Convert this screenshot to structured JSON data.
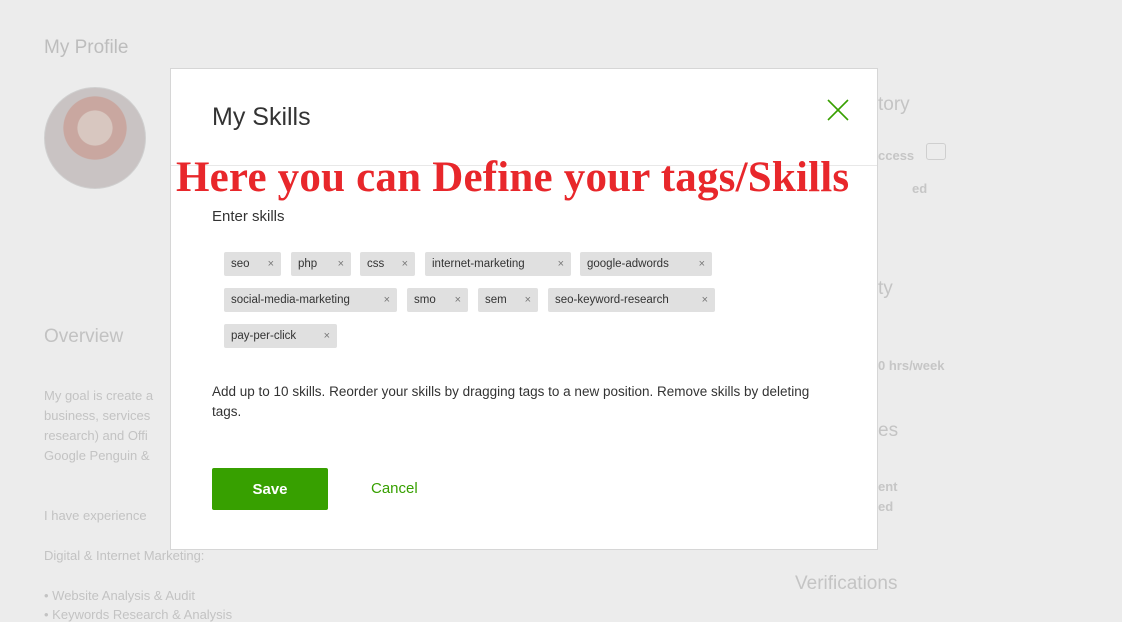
{
  "background": {
    "page_title": "My Profile",
    "overview_heading": "Overview",
    "overview_lines": [
      "My goal is create a",
      "business, services",
      "research) and Offi",
      "Google Penguin &"
    ],
    "experience_line": "I have experience",
    "digital_line": "Digital & Internet Marketing:",
    "bullets": [
      "• Website Analysis & Audit",
      "• Keywords Research & Analysis"
    ],
    "right_headings": [
      "tory",
      "ty",
      "es",
      "Verifications"
    ],
    "right_small": [
      "ccess",
      "ed",
      "0 hrs/week",
      "ent",
      "ed"
    ]
  },
  "modal": {
    "title": "My Skills",
    "enter_label": "Enter skills",
    "tags": [
      "seo",
      "php",
      "css",
      "internet-marketing",
      "google-adwords",
      "social-media-marketing",
      "smo",
      "sem",
      "seo-keyword-research",
      "pay-per-click"
    ],
    "remove_glyph": "×",
    "help_text": "Add up to 10 skills. Reorder your skills by dragging tags to a new position. Remove skills by deleting tags.",
    "save_label": "Save",
    "cancel_label": "Cancel"
  },
  "annotation": "Here you can Define your tags/Skills",
  "colors": {
    "accent": "#37a000",
    "annotation": "#e8272b",
    "tag_bg": "#e0e0e0"
  },
  "icons": [
    "close-icon",
    "chat-icon"
  ]
}
